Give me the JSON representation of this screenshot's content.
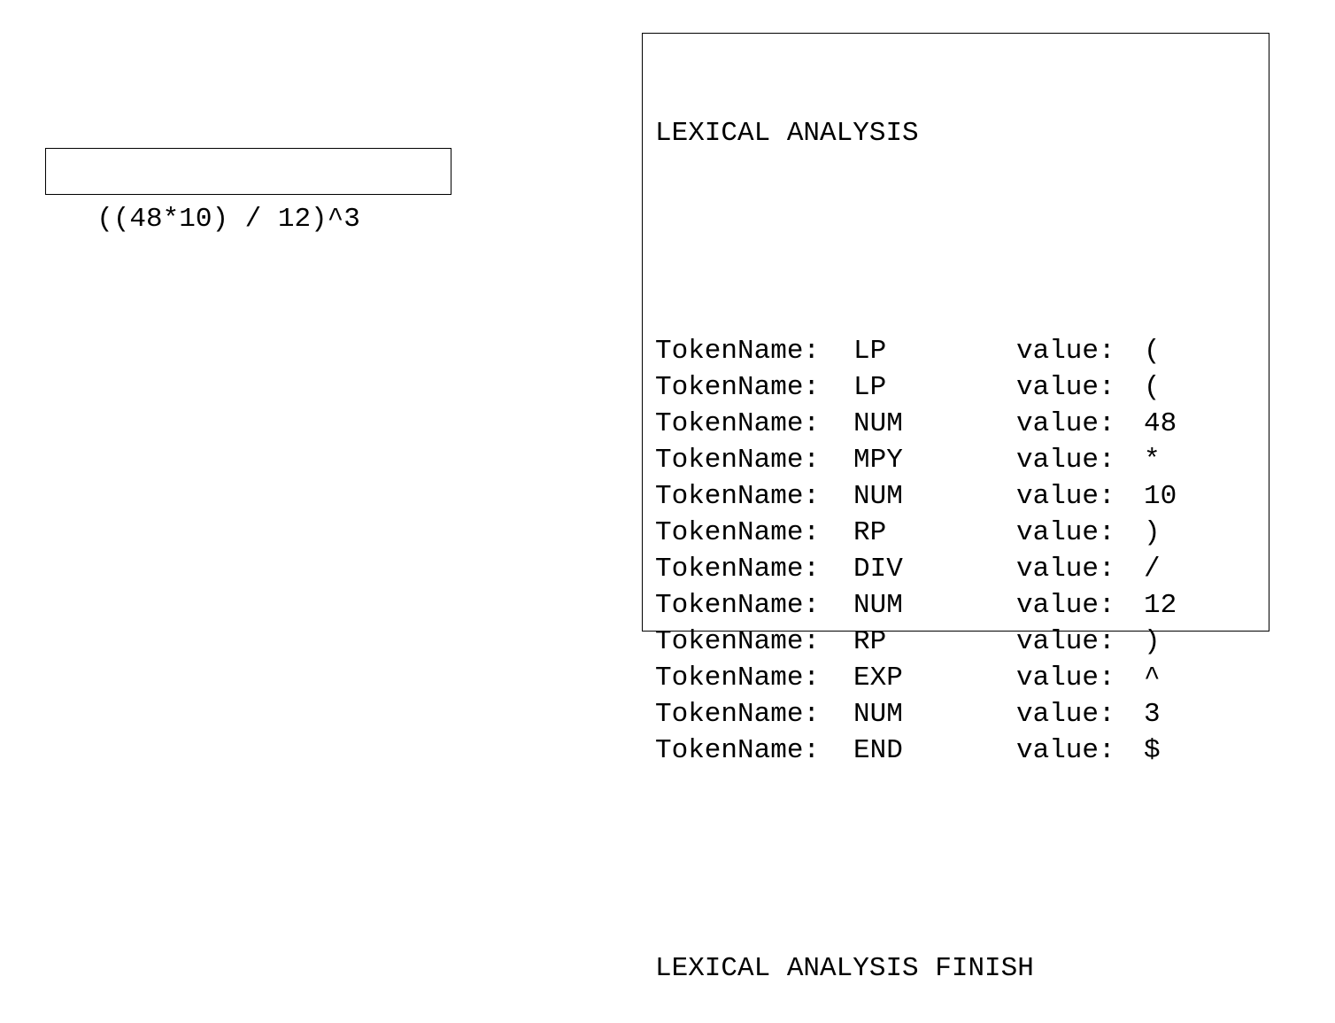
{
  "input": {
    "expression": "((48*10) / 12)^3"
  },
  "output": {
    "header": "LEXICAL ANALYSIS",
    "token_prefix": "TokenName:",
    "value_prefix": "value:",
    "tokens": [
      {
        "name": "LP",
        "value": "("
      },
      {
        "name": "LP",
        "value": "("
      },
      {
        "name": "NUM",
        "value": "48"
      },
      {
        "name": "MPY",
        "value": "*"
      },
      {
        "name": "NUM",
        "value": "10"
      },
      {
        "name": "RP",
        "value": ")"
      },
      {
        "name": "DIV",
        "value": "/"
      },
      {
        "name": "NUM",
        "value": "12"
      },
      {
        "name": "RP",
        "value": ")"
      },
      {
        "name": "EXP",
        "value": "^"
      },
      {
        "name": "NUM",
        "value": "3"
      },
      {
        "name": "END",
        "value": "$"
      }
    ],
    "footer": "LEXICAL ANALYSIS FINISH"
  }
}
